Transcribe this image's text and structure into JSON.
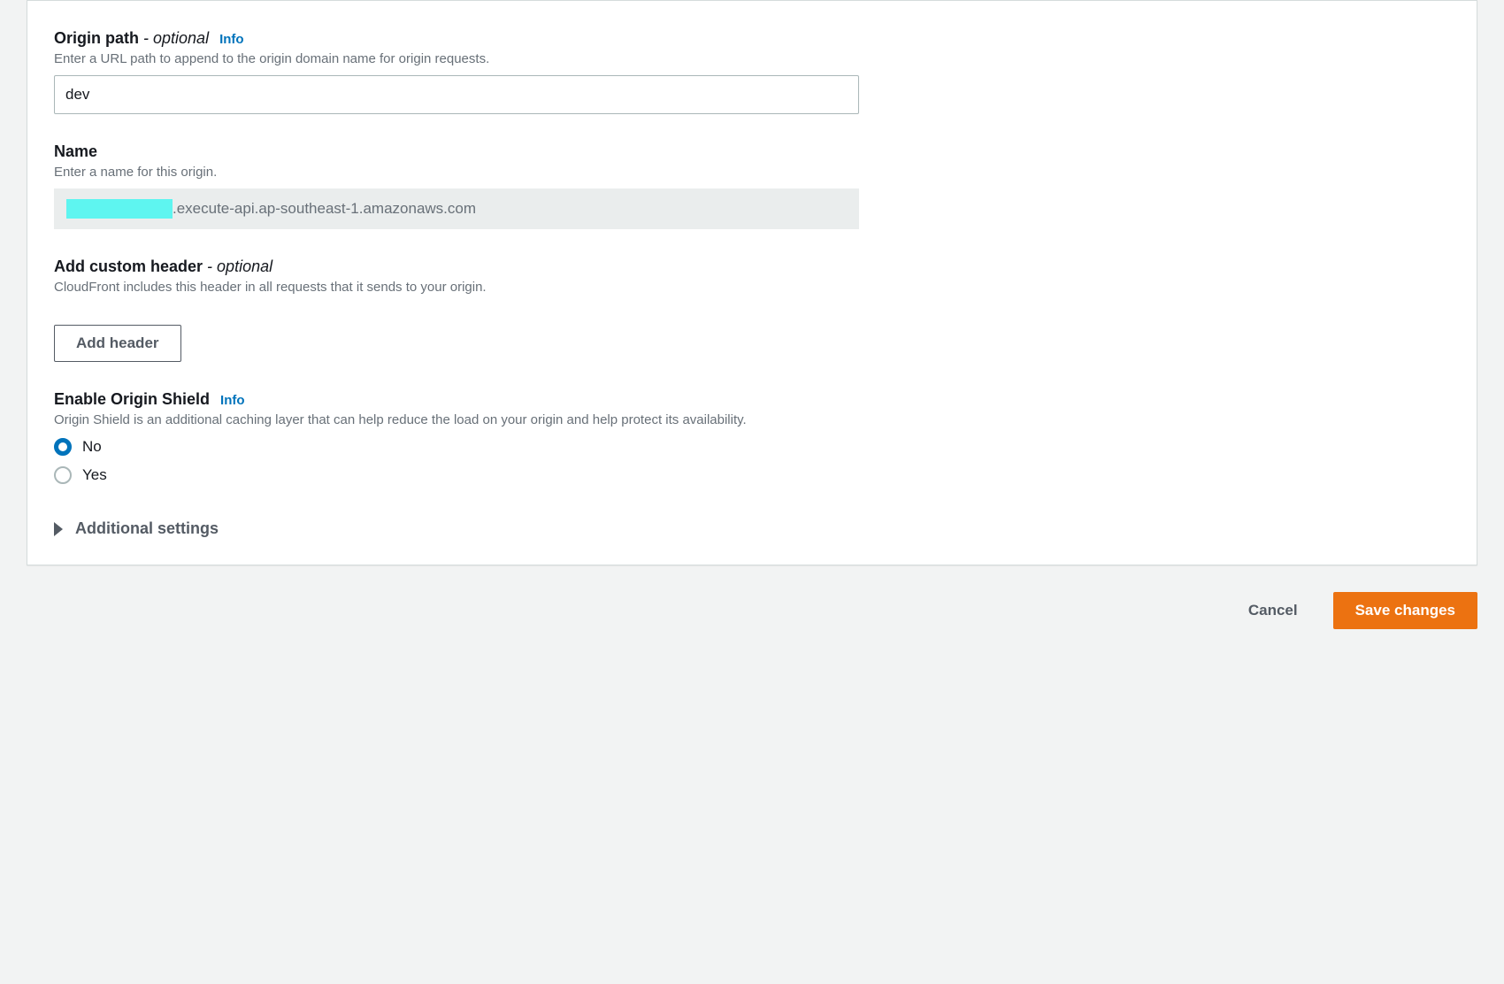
{
  "origin_path": {
    "label": "Origin path",
    "optional": "- optional",
    "info": "Info",
    "description": "Enter a URL path to append to the origin domain name for origin requests.",
    "value": "dev"
  },
  "name": {
    "label": "Name",
    "description": "Enter a name for this origin.",
    "value_suffix": ".execute-api.ap-southeast-1.amazonaws.com"
  },
  "custom_header": {
    "label": "Add custom header",
    "optional": "- optional",
    "description": "CloudFront includes this header in all requests that it sends to your origin.",
    "add_button": "Add header"
  },
  "origin_shield": {
    "label": "Enable Origin Shield",
    "info": "Info",
    "description": "Origin Shield is an additional caching layer that can help reduce the load on your origin and help protect its availability.",
    "options": {
      "no": "No",
      "yes": "Yes"
    },
    "selected": "no"
  },
  "additional_settings": {
    "label": "Additional settings"
  },
  "footer": {
    "cancel": "Cancel",
    "save": "Save changes"
  }
}
